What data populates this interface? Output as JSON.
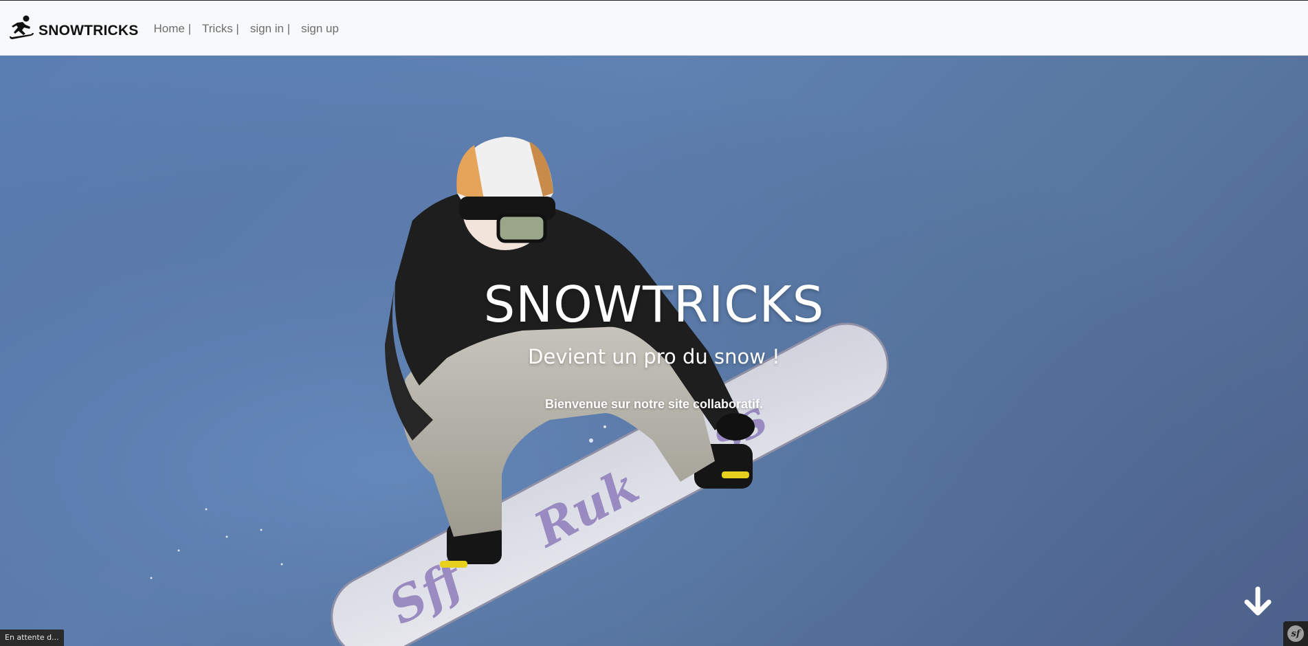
{
  "navbar": {
    "brand_text": "SNOWTRICKS",
    "brand_icon": "snowboarder-icon",
    "links": [
      {
        "label": "Home |"
      },
      {
        "label": "Tricks |"
      },
      {
        "label": "sign in |"
      },
      {
        "label": "sign up"
      }
    ]
  },
  "hero": {
    "title": "SNOWTRICKS",
    "subtitle": "Devient un pro du snow !",
    "text": "Bienvenue sur notre site collaboratif.",
    "scroll_icon": "arrow-down-icon"
  },
  "status_bar": {
    "text": "En attente d..."
  },
  "debug_toolbar": {
    "logo_text": "sf"
  },
  "colors": {
    "sky": "#5b7eb2",
    "navbar_bg": "#f8f9fa",
    "nav_link": "#6c6c6c",
    "hero_text": "#ffffff"
  }
}
